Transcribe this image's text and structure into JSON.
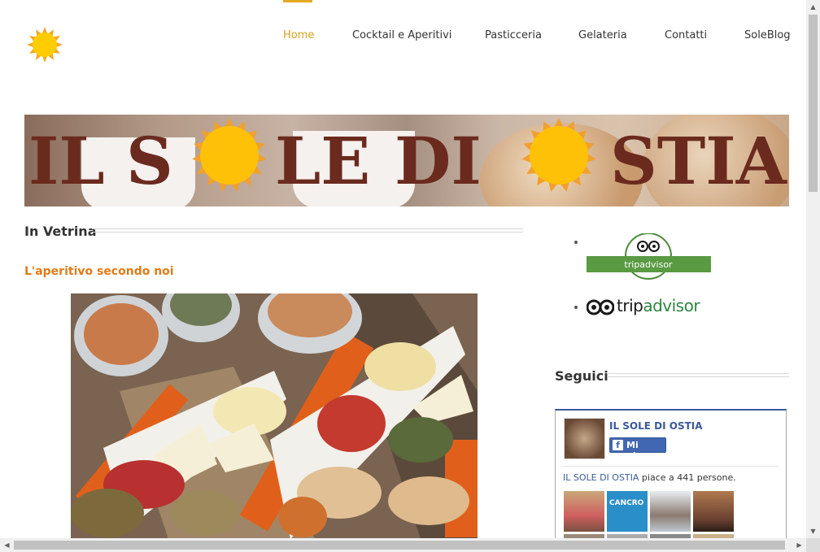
{
  "header": {
    "logo_icon": "sun-icon",
    "nav": [
      {
        "label": "Home",
        "active": true
      },
      {
        "label": "Cocktail e Aperitivi",
        "active": false
      },
      {
        "label": "Pasticceria",
        "active": false
      },
      {
        "label": "Gelateria",
        "active": false
      },
      {
        "label": "Contatti",
        "active": false
      },
      {
        "label": "SoleBlog",
        "active": false
      }
    ]
  },
  "banner": {
    "text": "IL SOLE DI OSTIA",
    "text_color": "#6b2a1e",
    "sun_color": "#ffc107"
  },
  "main": {
    "section_title": "In Vetrina",
    "post_title": "L'aperitivo secondo noi",
    "post_image": "aperitivo-platter-photo"
  },
  "sidebar": {
    "tripadvisor_badge_text": "tripadvisor",
    "tripadvisor_logo_text_1": "trip",
    "tripadvisor_logo_text_2": "advisor",
    "follow_title": "Seguici",
    "facebook": {
      "page_name": "IL SOLE DI OSTIA",
      "like_label": "Mi piace",
      "count_link": "IL SOLE DI OSTIA",
      "count_text": " piace a 441 persone.",
      "face_4_text": "CANCRO"
    }
  },
  "colors": {
    "accent": "#e5a823",
    "post_title": "#e07b17",
    "facebook": "#3b5998"
  }
}
